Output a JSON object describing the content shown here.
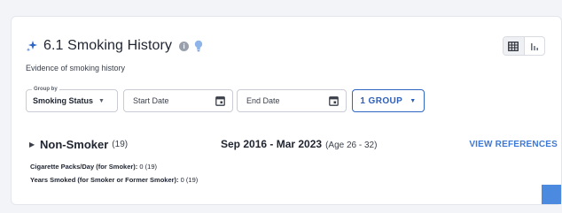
{
  "header": {
    "title": "6.1 Smoking History",
    "subtitle": "Evidence of smoking history"
  },
  "filters": {
    "group_by_legend": "Group by",
    "group_by_value": "Smoking Status",
    "start_date_placeholder": "Start Date",
    "end_date_placeholder": "End Date",
    "group_button_label": "1 GROUP"
  },
  "result": {
    "status": "Non-Smoker",
    "count": "(19)",
    "date_range": "Sep 2016 - Mar 2023",
    "age_range": "(Age 26 - 32)",
    "view_references_label": "VIEW REFERENCES",
    "metrics": [
      {
        "label": "Cigarette Packs/Day (for Smoker):",
        "value": "0 (19)"
      },
      {
        "label": "Years Smoked (for Smoker or Former Smoker):",
        "value": "0 (19)"
      }
    ]
  },
  "colors": {
    "accent": "#2f66c4",
    "link": "#3d78d6",
    "bulb": "#8fb4ea",
    "side_tab": "#4c8ae0"
  },
  "icons": {
    "sparkle": "sparkle-icon",
    "info": "info-icon",
    "bulb": "lightbulb-icon",
    "table": "table-grid-icon",
    "chart": "bar-chart-icon",
    "calendar": "calendar-icon",
    "expand": "chevron-right-icon",
    "caret": "caret-down-icon"
  }
}
